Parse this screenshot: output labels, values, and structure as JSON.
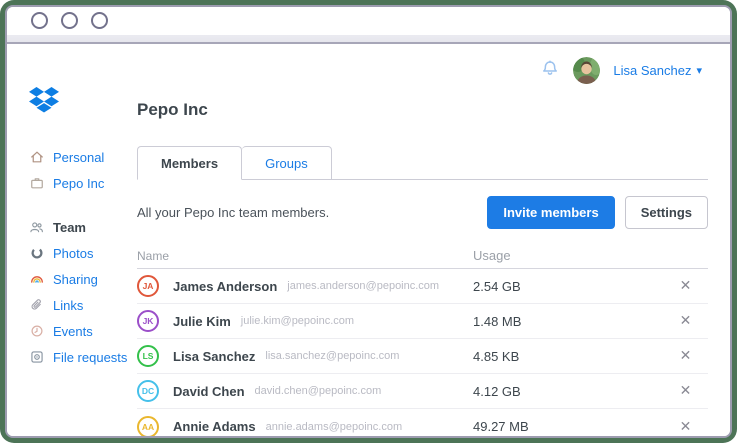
{
  "user": {
    "name": "Lisa Sanchez"
  },
  "icons": {
    "close": "✕",
    "caret_down": "▾"
  },
  "colors": {
    "accent_blue": "#1a7ce5",
    "frame_green": "#4d7457",
    "logo_blue": "#0d7ee3"
  },
  "sidebar": {
    "items": [
      {
        "label": "Personal",
        "icon": "home-icon"
      },
      {
        "label": "Pepo Inc",
        "icon": "briefcase-icon"
      },
      {
        "label": "Team",
        "icon": "team-icon",
        "active": true
      },
      {
        "label": "Photos",
        "icon": "photos-icon"
      },
      {
        "label": "Sharing",
        "icon": "rainbow-icon"
      },
      {
        "label": "Links",
        "icon": "paperclip-icon"
      },
      {
        "label": "Events",
        "icon": "clock-icon"
      },
      {
        "label": "File requests",
        "icon": "file-request-icon"
      }
    ]
  },
  "main": {
    "title": "Pepo Inc",
    "tabs": [
      {
        "label": "Members"
      },
      {
        "label": "Groups"
      }
    ],
    "description": "All your Pepo Inc team members.",
    "invite_button": "Invite members",
    "settings_button": "Settings",
    "table": {
      "columns": [
        "Name",
        "Usage"
      ],
      "rows": [
        {
          "initials": "JA",
          "name": "James Anderson",
          "email": "james.anderson@pepoinc.com",
          "usage": "2.54 GB",
          "color": "#e0573a"
        },
        {
          "initials": "JK",
          "name": "Julie Kim",
          "email": "julie.kim@pepoinc.com",
          "usage": "1.48 MB",
          "color": "#9b4fc9"
        },
        {
          "initials": "LS",
          "name": "Lisa Sanchez",
          "email": "lisa.sanchez@pepoinc.com",
          "usage": "4.85 KB",
          "color": "#33c04a"
        },
        {
          "initials": "DC",
          "name": "David Chen",
          "email": "david.chen@pepoinc.com",
          "usage": "4.12 GB",
          "color": "#45c0ea"
        },
        {
          "initials": "AA",
          "name": "Annie Adams",
          "email": "annie.adams@pepoinc.com",
          "usage": "49.27 MB",
          "color": "#eab72e"
        }
      ]
    }
  }
}
